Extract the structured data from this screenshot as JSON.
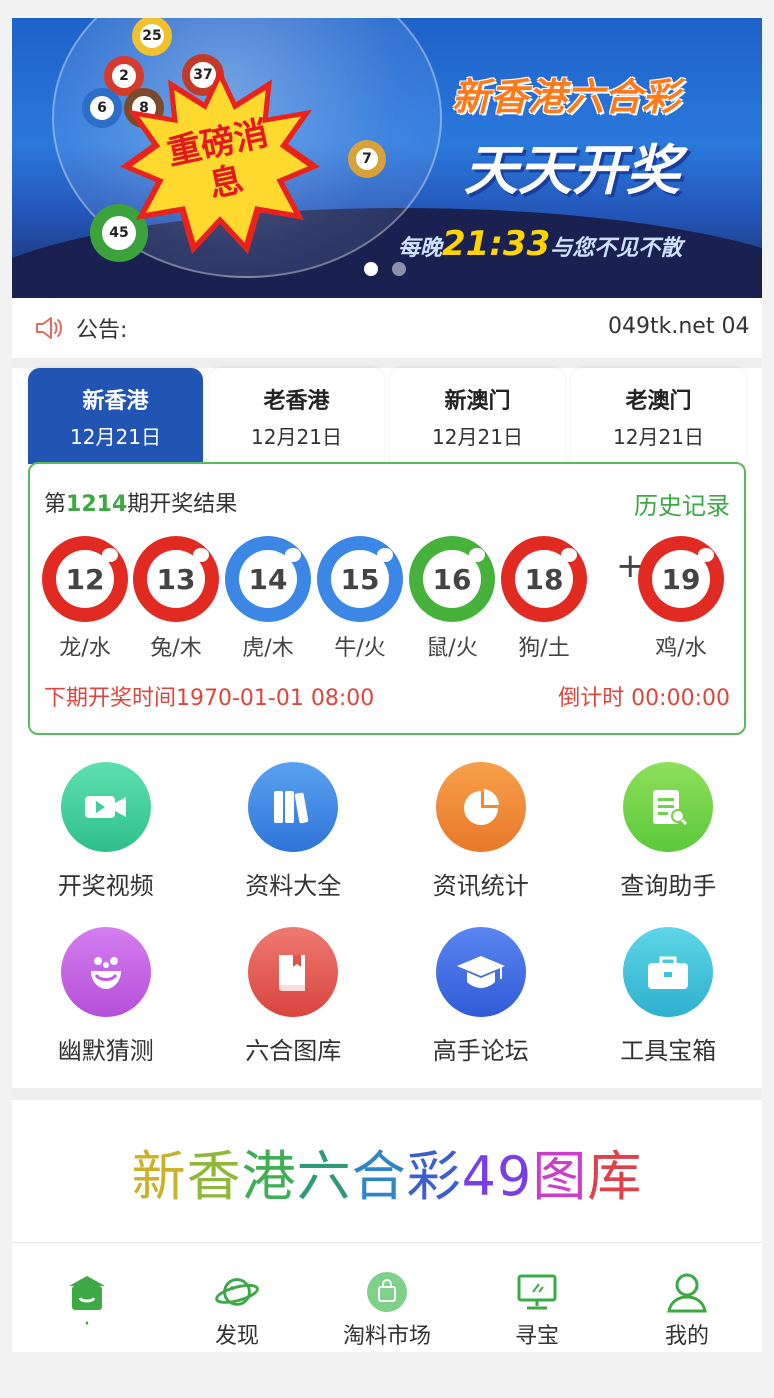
{
  "banner": {
    "title": "新香港六合彩",
    "subtitle": "天天开奖",
    "burst_text": "重磅消息",
    "time_prefix": "每晚",
    "time": "21:33",
    "time_suffix": "与您不见不散",
    "ball_numbers": [
      "25",
      "37",
      "2",
      "6",
      "8",
      "7",
      "45"
    ],
    "slide_count": 2,
    "active_slide": 1
  },
  "notice": {
    "icon": "speaker-icon",
    "label": "公告:",
    "marquee": "049tk.net 04"
  },
  "tabs": [
    {
      "name": "新香港",
      "date": "12月21日",
      "active": true
    },
    {
      "name": "老香港",
      "date": "12月21日",
      "active": false
    },
    {
      "name": "新澳门",
      "date": "12月21日",
      "active": false
    },
    {
      "name": "老澳门",
      "date": "12月21日",
      "active": false
    }
  ],
  "result": {
    "prefix": "第",
    "issue": "1214",
    "suffix": "期开奖结果",
    "history": "历史记录",
    "balls": [
      {
        "num": "12",
        "zodiac": "龙/水",
        "color": "red"
      },
      {
        "num": "13",
        "zodiac": "兔/木",
        "color": "red"
      },
      {
        "num": "14",
        "zodiac": "虎/木",
        "color": "blue"
      },
      {
        "num": "15",
        "zodiac": "牛/火",
        "color": "blue"
      },
      {
        "num": "16",
        "zodiac": "鼠/火",
        "color": "green"
      },
      {
        "num": "18",
        "zodiac": "狗/土",
        "color": "red"
      }
    ],
    "plus": "+",
    "special": {
      "num": "19",
      "zodiac": "鸡/水",
      "color": "red"
    },
    "next_draw": "下期开奖时间1970-01-01 08:00",
    "countdown": "倒计时 00:00:00"
  },
  "grid": [
    {
      "label": "开奖视频",
      "icon": "video-camera-icon",
      "color": "#3ecf9a"
    },
    {
      "label": "资料大全",
      "icon": "books-icon",
      "color": "#3b86e0"
    },
    {
      "label": "资讯统计",
      "icon": "pie-chart-icon",
      "color": "#f08a2c"
    },
    {
      "label": "查询助手",
      "icon": "notepad-search-icon",
      "color": "#6fd24a"
    },
    {
      "label": "幽默猜测",
      "icon": "clown-face-icon",
      "color": "#c45ee0"
    },
    {
      "label": "六合图库",
      "icon": "book-icon",
      "color": "#e2554f"
    },
    {
      "label": "高手论坛",
      "icon": "graduation-cap-icon",
      "color": "#3b6fe0"
    },
    {
      "label": "工具宝箱",
      "icon": "toolbox-icon",
      "color": "#3ec6d8"
    }
  ],
  "gallery": {
    "title_chars": [
      "新",
      "香",
      "港",
      "六",
      "合",
      "彩",
      "49",
      "图",
      "库"
    ],
    "char_colors": [
      "#c9b22a",
      "#8fb83a",
      "#3fae55",
      "#2f9a7a",
      "#2e86c9",
      "#3c5fd0",
      "#7a3fe0",
      "#c93fc9",
      "#e0404a"
    ]
  },
  "bottom_nav": [
    {
      "label": "·",
      "icon": "home-shop-icon",
      "active": true
    },
    {
      "label": "发现",
      "icon": "planet-icon",
      "active": false
    },
    {
      "label": "淘料市场",
      "icon": "market-bag-icon",
      "active": false
    },
    {
      "label": "寻宝",
      "icon": "monitor-icon",
      "active": false
    },
    {
      "label": "我的",
      "icon": "user-icon",
      "active": false
    }
  ],
  "colors": {
    "accent_green": "#3da944",
    "tab_active": "#2154b3",
    "red_ball": "#e02a22",
    "blue_ball": "#3c86e6",
    "green_ball": "#46b23b",
    "countdown_red": "#e0453a"
  }
}
